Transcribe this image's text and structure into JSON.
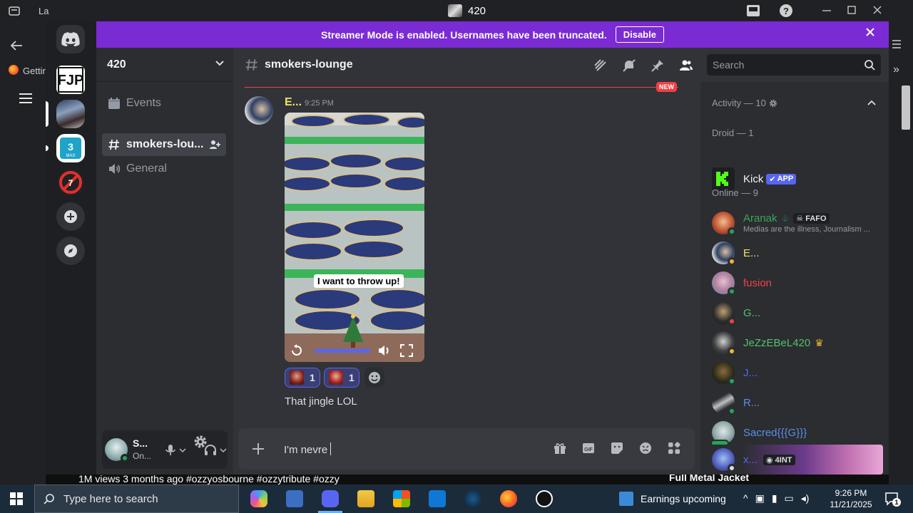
{
  "window": {
    "title": "420"
  },
  "browser": {
    "tab_partial": "La",
    "bookmark_partial": "Gettin",
    "video_info": "1M views  3 months ago  #ozzyosbourne #ozzytribute #ozzy",
    "side_video_title": "Full Metal Jacket"
  },
  "banner": {
    "text": "Streamer Mode is enabled. Usernames have been truncated.",
    "button": "Disable"
  },
  "server": {
    "name": "420"
  },
  "channels": [
    {
      "label": "Events"
    },
    {
      "label": "smokers-lou..."
    },
    {
      "label": "General"
    }
  ],
  "user_panel": {
    "name": "S...",
    "status": "On..."
  },
  "chat": {
    "channel": "smokers-lounge",
    "new_badge": "NEW",
    "author": "E...",
    "time": "9:25 PM",
    "caption": "I want to throw up!",
    "reactions": [
      {
        "count": "1"
      },
      {
        "count": "1"
      }
    ],
    "second_message": "That jingle LOL"
  },
  "search": {
    "placeholder": "Search"
  },
  "composer": {
    "value": "I'm nevre"
  },
  "members": {
    "activity_label": "Activity — 10",
    "droid_label": "Droid — 1",
    "kick": {
      "name": "Kick",
      "tag": "APP"
    },
    "online_label": "Online — 9",
    "list": [
      {
        "name": "Aranak",
        "color": "#3ba55c",
        "tag": "FAFO",
        "status_text": "Medias are the illness, Journalism ..."
      },
      {
        "name": "E...",
        "color": "#f0e36b"
      },
      {
        "name": "fusion",
        "color": "#ed4245"
      },
      {
        "name": "G...",
        "color": "#57c06b"
      },
      {
        "name": "JeZzEBeL420",
        "color": "#57c06b",
        "crown": "♛"
      },
      {
        "name": "J...",
        "color": "#5865f2"
      },
      {
        "name": "R...",
        "color": "#5c8ee6"
      },
      {
        "name": "Sacred{{{G}}}",
        "color": "#5c8ee6"
      },
      {
        "name": "x...",
        "color": "#5865f2",
        "tag": "4INT"
      }
    ]
  },
  "taskbar": {
    "search_placeholder": "Type here to search",
    "weather": "Earnings upcoming",
    "time": "9:26 PM",
    "date": "11/21/2025",
    "notif_count": "1"
  },
  "colors": {
    "blurple": "#5865f2",
    "banner": "#7b2bd4",
    "new_red": "#f23f43",
    "online": "#23a55a"
  }
}
